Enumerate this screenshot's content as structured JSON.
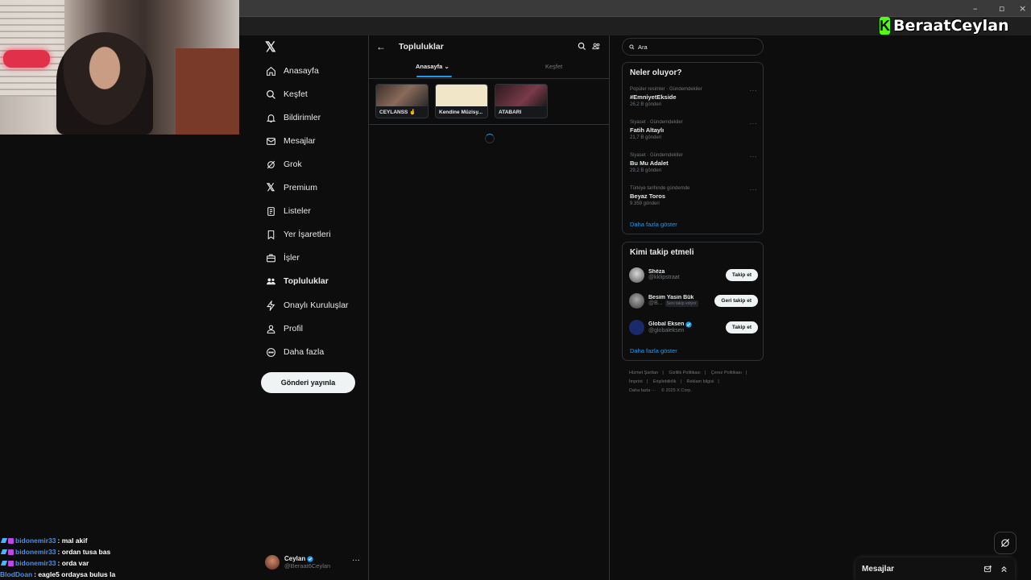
{
  "overlay": {
    "brand_letter": "K",
    "brand_name": "BeraatCeylan",
    "chat": [
      {
        "user": "bidonemir33",
        "message": ": mal akif"
      },
      {
        "user": "bidonemir33",
        "message": ": ordan tusa bas"
      },
      {
        "user": "bidonemir33",
        "message": ": orda var"
      },
      {
        "user": "BlodDoan",
        "message": ": eagle5 ordaysa bulus la"
      }
    ]
  },
  "nav": {
    "items": [
      {
        "label": "Anasayfa",
        "icon": "home-icon"
      },
      {
        "label": "Keşfet",
        "icon": "search-icon"
      },
      {
        "label": "Bildirimler",
        "icon": "bell-icon"
      },
      {
        "label": "Mesajlar",
        "icon": "mail-icon"
      },
      {
        "label": "Grok",
        "icon": "grok-icon"
      },
      {
        "label": "Premium",
        "icon": "x-premium-icon"
      },
      {
        "label": "Listeler",
        "icon": "list-icon"
      },
      {
        "label": "Yer İşaretleri",
        "icon": "bookmark-icon"
      },
      {
        "label": "İşler",
        "icon": "briefcase-icon"
      },
      {
        "label": "Topluluklar",
        "icon": "communities-icon"
      },
      {
        "label": "Onaylı Kuruluşlar",
        "icon": "lightning-icon"
      },
      {
        "label": "Profil",
        "icon": "person-icon"
      },
      {
        "label": "Daha fazla",
        "icon": "more-circle-icon"
      }
    ],
    "post_button": "Gönderi yayınla",
    "account": {
      "name": "Ceylan",
      "handle": "@Beraat6Ceylan",
      "more": "···"
    }
  },
  "center": {
    "title": "Topluluklar",
    "tabs": [
      {
        "label": "Anasayfa",
        "active": true
      },
      {
        "label": "Keşfet",
        "active": false
      }
    ],
    "communities": [
      {
        "label": "CEYLANSS 🤞"
      },
      {
        "label": "Kendine Müzisy..."
      },
      {
        "label": "ATABARI"
      }
    ]
  },
  "right": {
    "search_placeholder": "Ara",
    "trends_title": "Neler oluyor?",
    "trends": [
      {
        "meta": "Popüler resimler · Gündemdekiler",
        "name": "#EmniyetEkside",
        "count": "26,2 B gönderi"
      },
      {
        "meta": "Siyaset · Gündemdekiler",
        "name": "Fatih Altaylı",
        "count": "21,7 B gönderi"
      },
      {
        "meta": "Siyaset · Gündemdekiler",
        "name": "Bu Mu Adalet",
        "count": "29,2 B gönderi"
      },
      {
        "meta": "Türkiye tarihinde gündemde",
        "name": "Beyaz Toros",
        "count": "9.359 gönderi"
      }
    ],
    "trends_more": "···",
    "show_more": "Daha fazla göster",
    "follow_title": "Kimi takip etmeli",
    "follow": [
      {
        "name": "Shéza",
        "handle": "@kklipstraat",
        "button": "Takip et",
        "verified": false,
        "follows_you": ""
      },
      {
        "name": "Besim Yasin Bük",
        "handle": "@B...",
        "button": "Geri takip et",
        "verified": false,
        "follows_you": "Seni takip ediyor"
      },
      {
        "name": "Global Eksen",
        "handle": "@globaleksen",
        "button": "Takip et",
        "verified": true,
        "follows_you": ""
      }
    ],
    "follow_show_more": "Daha fazla göster",
    "footer": [
      "Hizmet Şartları",
      "|",
      "Gizlilik Politikası",
      "|",
      "Çerez Politikası",
      "|",
      "İmprint",
      "|",
      "Erişilebilirlik",
      "|",
      "Reklam bilgisi",
      "|",
      "Daha fazla ···",
      "© 2025 X Corp."
    ]
  },
  "dock": {
    "title": "Mesajlar"
  },
  "colors": {
    "accent": "#1d9bf0",
    "background": "#0d0d0d",
    "border": "#2f3336",
    "kick_green": "#53fc18"
  }
}
